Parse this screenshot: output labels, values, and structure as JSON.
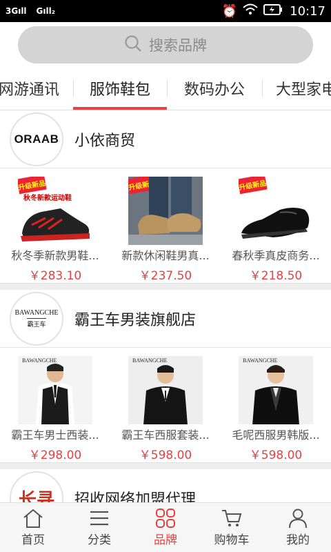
{
  "status_bar": {
    "signal1": "3G",
    "signal2": "G",
    "time": "10:17"
  },
  "search": {
    "placeholder": "搜索品牌"
  },
  "tabs": [
    {
      "label": "网游通讯"
    },
    {
      "label": "服饰鞋包"
    },
    {
      "label": "数码办公"
    },
    {
      "label": "大型家电"
    }
  ],
  "stores": [
    {
      "name": "小依商贸",
      "logo_text": "ORAAB",
      "products": [
        {
          "name": "秋冬季新款男鞋...",
          "price": "￥283.10",
          "badge": "升级新品",
          "caption": "秋冬新款运动鞋"
        },
        {
          "name": "新款休闲鞋男真...",
          "price": "￥237.50",
          "badge": "升级新品"
        },
        {
          "name": "春秋季真皮商务...",
          "price": "￥218.50",
          "badge": "升级新品"
        }
      ]
    },
    {
      "name": "霸王车男装旗舰店",
      "logo_text": "BAWANGCHE",
      "logo_sub": "霸王车",
      "products": [
        {
          "name": "霸王车男士西装...",
          "price": "￥298.00",
          "brand": "BAWANGCHE"
        },
        {
          "name": "霸王车西服套装...",
          "price": "￥598.00",
          "brand": "BAWANGCHE"
        },
        {
          "name": "毛呢西服男韩版...",
          "price": "￥598.00",
          "brand": "BAWANGCHE"
        }
      ]
    },
    {
      "name": "招收网络加盟代理",
      "logo_text": "长寻"
    }
  ],
  "tabbar": [
    {
      "label": "首页"
    },
    {
      "label": "分类"
    },
    {
      "label": "品牌"
    },
    {
      "label": "购物车"
    },
    {
      "label": "我的"
    }
  ],
  "colors": {
    "accent": "#e8403e",
    "search_bg": "#d4d4d4"
  }
}
